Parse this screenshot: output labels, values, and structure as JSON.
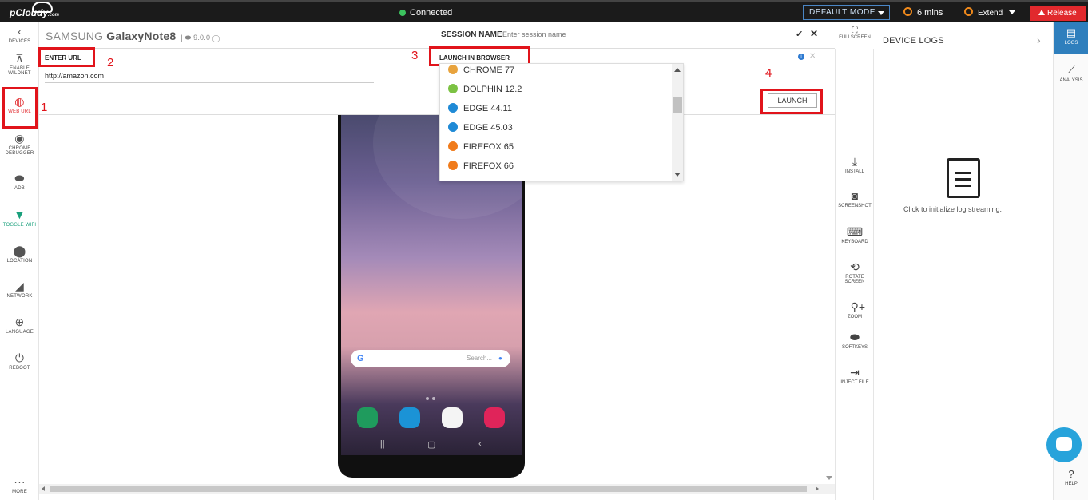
{
  "topbar": {
    "logo": "pCloudy",
    "logo_suffix": ".com",
    "status": "Connected",
    "mode": "DEFAULT MODE",
    "timer": "6 mins",
    "extend": "Extend",
    "release": "Release"
  },
  "leftbar": {
    "devices": "DEVICES",
    "wildnet": "ENABLE WILDNET",
    "weburl": "WEB URL",
    "chrome": "CHROME DEBUGGER",
    "adb": "ADB",
    "wifi": "TOGGLE WIFI",
    "location": "LOCATION",
    "network": "NETWORK",
    "language": "LANGUAGE",
    "reboot": "REBOOT",
    "more": "MORE"
  },
  "device": {
    "brand": "SAMSUNG",
    "model": "GalaxyNote8",
    "version": "9.0.0",
    "session_label": "SESSION NAME",
    "session_placeholder": "Enter session name",
    "fullscreen": "FULLSCREEN"
  },
  "url_panel": {
    "enter_url_label": "ENTER URL",
    "url_value": "http://amazon.com",
    "launch_in_browser_label": "LAUNCH IN BROWSER",
    "launch_button": "LAUNCH"
  },
  "browsers": [
    {
      "name": "CHROME 77",
      "color": "#e8a33d"
    },
    {
      "name": "DOLPHIN 12.2",
      "color": "#7cc243"
    },
    {
      "name": "EDGE 44.11",
      "color": "#1f8ad6"
    },
    {
      "name": "EDGE 45.03",
      "color": "#1f8ad6"
    },
    {
      "name": "FIREFOX 65",
      "color": "#f07b1b"
    },
    {
      "name": "FIREFOX 66",
      "color": "#f07b1b"
    }
  ],
  "annotations": {
    "n1": "1",
    "n2": "2",
    "n3": "3",
    "n4": "4"
  },
  "phone": {
    "search_placeholder": "Search..."
  },
  "tools": {
    "install": "INSTALL",
    "screenshot": "SCREENSHOT",
    "keyboard": "KEYBOARD",
    "rotate": "ROTATE SCREEN",
    "zoom": "ZOOM",
    "softkeys": "SOFTKEYS",
    "inject": "INJECT FILE"
  },
  "logs": {
    "title": "DEVICE LOGS",
    "hint": "Click to initialize log streaming."
  },
  "rightrail": {
    "logs": "LOGS",
    "analysis": "ANALYSIS",
    "help": "HELP"
  }
}
